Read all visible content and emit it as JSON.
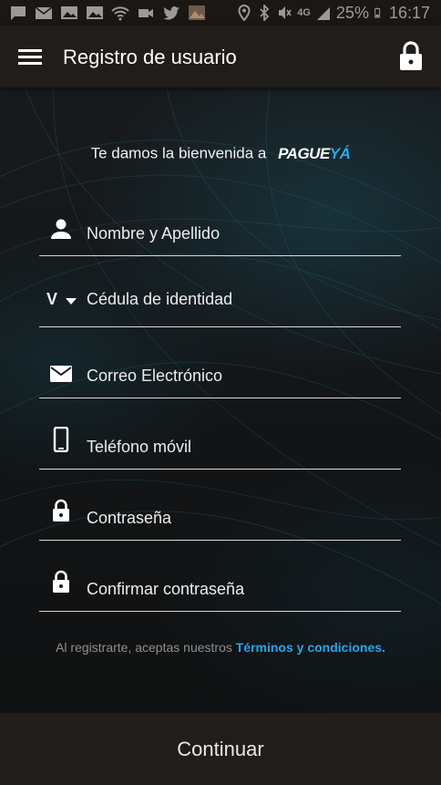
{
  "status_bar": {
    "battery_percent": "25%",
    "time": "16:17",
    "network": "4G",
    "icons_left": [
      "chat-icon",
      "mail-icon",
      "image-icon",
      "image-icon",
      "wifi-icon",
      "video-icon",
      "twitter-icon",
      "photo-icon"
    ],
    "icons_right": [
      "location-icon",
      "bluetooth-icon",
      "mute-icon",
      "signal-icon",
      "battery-icon"
    ]
  },
  "app_bar": {
    "title": "Registro de usuario",
    "menu_icon": "menu-icon",
    "lock_icon": "lock-icon"
  },
  "welcome": {
    "text": "Te damos la bienvenida a",
    "brand_part1": "PAGUE",
    "brand_part2": "YÁ"
  },
  "form": {
    "name_label": "Nombre y Apellido",
    "id_prefix": "V",
    "id_label": "Cédula de identidad",
    "email_label": "Correo Electrónico",
    "phone_label": "Teléfono móvil",
    "password_label": "Contraseña",
    "confirm_password_label": "Confirmar contraseña"
  },
  "terms": {
    "text": "Al registrarte, aceptas nuestros",
    "link": "Términos y condiciones."
  },
  "continue_label": "Continuar",
  "colors": {
    "accent": "#2aa4ea",
    "bar_background": "#201d1a",
    "field_line": "#d9d9d9"
  }
}
